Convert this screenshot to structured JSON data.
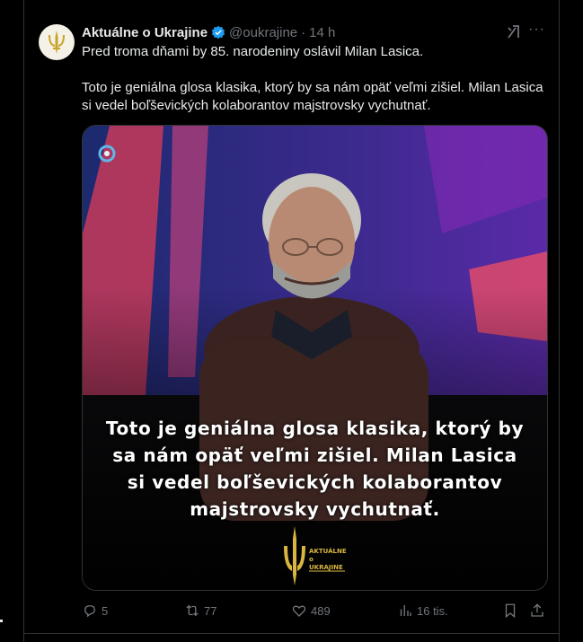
{
  "tweet": {
    "author_name": "Aktuálne o Ukrajine",
    "handle": "@oukrajine",
    "separator": "·",
    "time": "14 h",
    "more_label": "···",
    "text_line1": "Pred troma dňami by 85. narodeniny oslávil Milan Lasica.",
    "text_line2": "Toto je geniálna glosa klasika, ktorý by sa nám opäť veľmi zišiel. Milan Lasica si vedel boľševických kolaborantov majstrovsky vychutnať."
  },
  "video": {
    "caption": "Toto je geniálna glosa klasika, ktorý by sa nám opäť veľmi zišiel. Milan Lasica si vedel boľševických kolaborantov majstrovsky vychutnať.",
    "logo_line1": "AKTUÁLNE",
    "logo_line2": "o",
    "logo_line3": "UKRAJINE"
  },
  "actions": {
    "replies": "5",
    "reposts": "77",
    "likes": "489",
    "views": "16 tis."
  },
  "icons": [
    "verified-badge-icon",
    "grok-icon",
    "more-icon",
    "reply-icon",
    "repost-icon",
    "like-icon",
    "views-icon",
    "bookmark-icon",
    "share-icon",
    "tv-channel-icon",
    "trident-logo-icon"
  ],
  "colors": {
    "background": "#000000",
    "text": "#e7e9ea",
    "muted": "#71767b",
    "verified": "#1d9bf0",
    "logo_gold": "#d9b640"
  }
}
